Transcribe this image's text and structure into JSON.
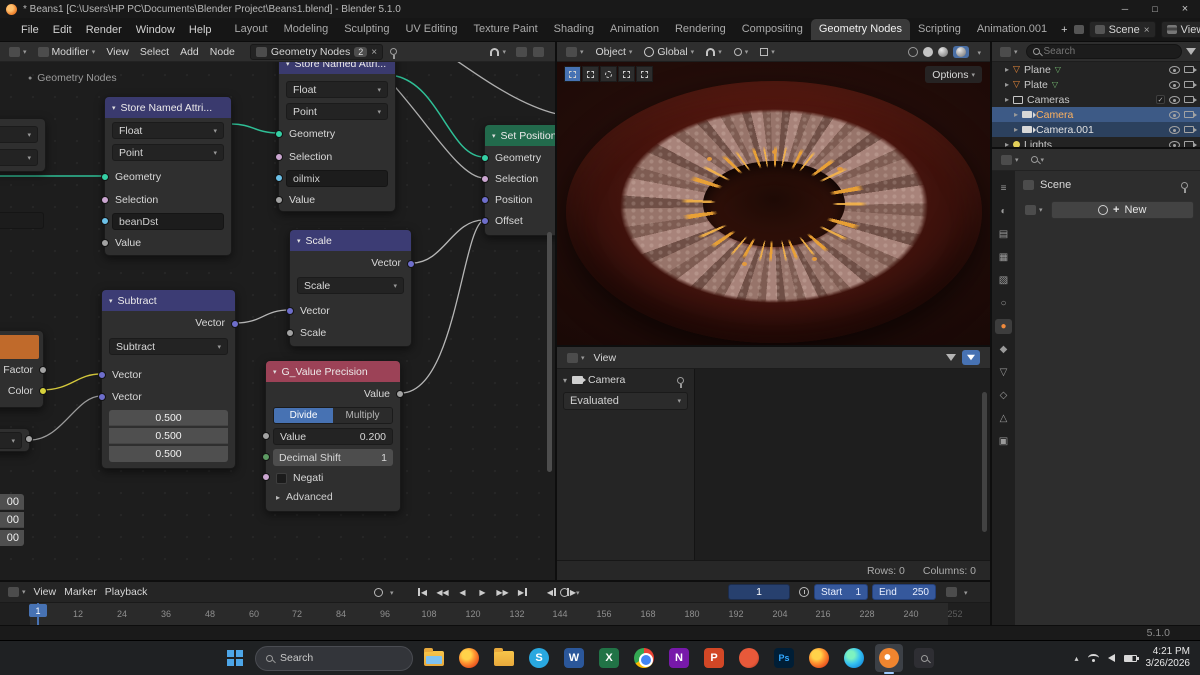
{
  "colors": {
    "accent": "#4772b3",
    "selected_text": "#ffb25e",
    "socket_geometry": "#35d0a5",
    "socket_vector": "#6e6ecb",
    "socket_boolean": "#cba6d1",
    "socket_value": "#a3a3a3",
    "group_node_header": "#9c4257"
  },
  "titlebar": {
    "title": "* Beans1 [C:\\Users\\HP PC\\Documents\\Blender Project\\Beans1.blend] - Blender 5.1.0"
  },
  "menubar": {
    "menus": [
      "File",
      "Edit",
      "Render",
      "Window",
      "Help"
    ],
    "tabs": [
      "Layout",
      "Modeling",
      "Sculpting",
      "UV Editing",
      "Texture Paint",
      "Shading",
      "Animation",
      "Rendering",
      "Compositing",
      "Geometry Nodes",
      "Scripting",
      "Animation.001"
    ],
    "add_tab": "+",
    "scene": "Scene",
    "viewlayer": "ViewLayer"
  },
  "node_editor": {
    "header": {
      "mode": "Modifier",
      "menu_view": "View",
      "menu_select": "Select",
      "menu_add": "Add",
      "menu_node": "Node",
      "tree_name": "Geometry Nodes",
      "user_count": "2"
    },
    "breadcrumb": "Geometry Nodes",
    "store1": {
      "title": "Store Named Attri...",
      "type": "Float",
      "domain": "Point",
      "geometry": "Geometry",
      "selection": "Selection",
      "name": "beanDst",
      "value": "Value"
    },
    "store2": {
      "title": "Store Named Attri...",
      "type": "Float",
      "domain": "Point",
      "geometry": "Geometry",
      "selection": "Selection",
      "name": "oilmix",
      "value": "Value"
    },
    "setpos": {
      "title": "Set Position",
      "geometry": "Geometry",
      "selection": "Selection",
      "position": "Position",
      "offset": "Offset"
    },
    "scale": {
      "title": "Scale",
      "out": "Vector",
      "op": "Scale",
      "vector": "Vector",
      "scale": "Scale"
    },
    "subtract": {
      "title": "Subtract",
      "out": "Vector",
      "op": "Subtract",
      "vector1": "Vector",
      "vector2": "Vector",
      "v1": "0.500",
      "v2": "0.500",
      "v3": "0.500"
    },
    "gvalue": {
      "title": "G_Value Precision",
      "out": "Value",
      "divide": "Divide",
      "multiply": "Multiply",
      "value_label": "Value",
      "value": "0.200",
      "shift_label": "Decimal Shift",
      "shift_value": "1",
      "negate": "Negati",
      "advanced": "Advanced"
    },
    "left_node": {
      "factor": "Factor",
      "color": "Color"
    },
    "left_fields": [
      "00",
      "00",
      "00"
    ]
  },
  "viewport": {
    "mode": "Object",
    "orientation": "Global",
    "options": "Options"
  },
  "spreadsheet": {
    "view": "View",
    "object": "Camera",
    "evaluated": "Evaluated",
    "rows": "Rows: 0",
    "columns": "Columns: 0"
  },
  "outliner": {
    "search_placeholder": "Search",
    "rows": [
      {
        "label": "Plane"
      },
      {
        "label": "Plate"
      },
      {
        "label": "Cameras"
      },
      {
        "label": "Camera"
      },
      {
        "label": "Camera.001"
      },
      {
        "label": "Lights"
      }
    ]
  },
  "properties": {
    "breadcrumb": "Scene",
    "new_button": "New"
  },
  "timeline": {
    "menu_view": "View",
    "menu_marker": "Marker",
    "menu_playback": "Playback",
    "current_frame": "1",
    "start_label": "Start",
    "start_value": "1",
    "end_label": "End",
    "end_value": "250",
    "playhead": "1",
    "ticks": [
      "1",
      "12",
      "24",
      "36",
      "48",
      "60",
      "72",
      "84",
      "96",
      "108",
      "120",
      "132",
      "144",
      "156",
      "168",
      "180",
      "192",
      "204",
      "216",
      "228",
      "240",
      "252"
    ]
  },
  "statusbar": {
    "version": "5.1.0"
  },
  "taskbar": {
    "search": "Search",
    "apps": [
      {
        "name": "file-explorer",
        "letter": ""
      },
      {
        "name": "firefox",
        "letter": ""
      },
      {
        "name": "folder",
        "letter": ""
      },
      {
        "name": "skype",
        "letter": "S"
      },
      {
        "name": "word",
        "letter": "W"
      },
      {
        "name": "excel",
        "letter": "X"
      },
      {
        "name": "chrome",
        "letter": ""
      },
      {
        "name": "onenote",
        "letter": "N"
      },
      {
        "name": "powerpoint",
        "letter": "P"
      },
      {
        "name": "brave",
        "letter": ""
      },
      {
        "name": "photoshop",
        "letter": "Ps"
      },
      {
        "name": "firefox-2",
        "letter": ""
      },
      {
        "name": "edge",
        "letter": ""
      },
      {
        "name": "blender",
        "letter": ""
      },
      {
        "name": "search-tool",
        "letter": ""
      }
    ],
    "time": "4:21 PM",
    "date": "3/26/2026"
  }
}
